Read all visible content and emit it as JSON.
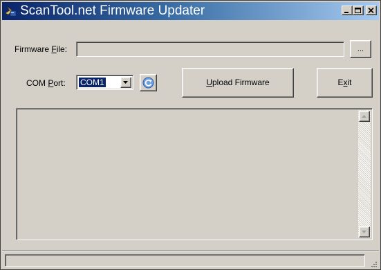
{
  "window": {
    "title": "ScanTool.net Firmware Updater"
  },
  "form": {
    "firmware_label_pre": "Firmware ",
    "firmware_label_key": "F",
    "firmware_label_post": "ile:",
    "firmware_file_value": "",
    "browse_label": "...",
    "com_label_pre": "COM ",
    "com_label_key": "P",
    "com_label_post": "ort:",
    "com_port_selected": "COM1",
    "upload_key": "U",
    "upload_rest": "pload Firmware",
    "exit_pre": "E",
    "exit_key": "x",
    "exit_post": "it"
  },
  "log": {
    "text": ""
  },
  "status": {
    "text": ""
  },
  "icons": {
    "app": "app-icon",
    "refresh": "refresh-icon",
    "minimize": "minimize-icon",
    "maximize": "maximize-icon",
    "close": "close-icon"
  }
}
